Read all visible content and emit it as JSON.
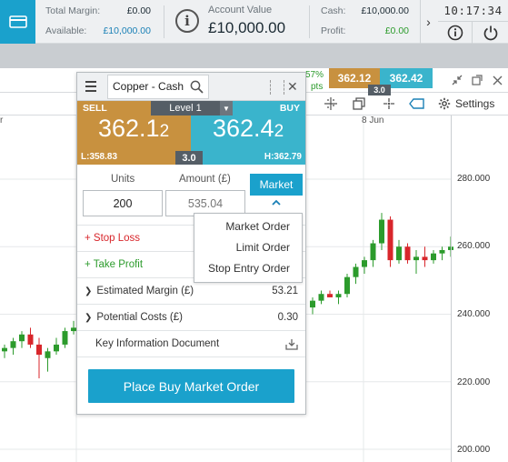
{
  "account_bar": {
    "total_margin_label": "Total Margin:",
    "total_margin_value": "£0.00",
    "available_label": "Available:",
    "available_value": "£10,000.00",
    "account_value_label": "Account Value",
    "account_value": "£10,000.00",
    "cash_label": "Cash:",
    "cash_value": "£10,000.00",
    "profit_label": "Profit:",
    "profit_value": "£0.00",
    "clock": "10:17:34",
    "icons": [
      "wallet-icon",
      "info-icon",
      "chevron-right-icon",
      "help-icon",
      "power-icon"
    ]
  },
  "chart_window": {
    "change_pct_partial": "57%",
    "change_pts_partial": "pts",
    "mini_sell_price": "362.12",
    "mini_buy_price": "362.42",
    "mini_spread": "3.0",
    "settings_label": "Settings",
    "date_labels": [
      "r",
      "8 Jun"
    ],
    "y_axis_labels": [
      "280.000",
      "260.000",
      "240.000",
      "220.000",
      "200.000"
    ],
    "icons": [
      "collapse-icon",
      "popout-icon",
      "close-icon",
      "crosshair-icon",
      "layers-icon",
      "cursor-icon",
      "tag-icon",
      "gear-icon"
    ]
  },
  "deal_ticket": {
    "market_name": "Copper - Cash",
    "sell_label": "SELL",
    "buy_label": "BUY",
    "level_label": "Level 1",
    "sell_price_main": "362.1",
    "sell_price_small": "2",
    "buy_price_main": "362.4",
    "buy_price_small": "2",
    "spread": "3.0",
    "low_label": "L:358.83",
    "high_label": "H:362.79",
    "units_label": "Units",
    "amount_label": "Amount (£)",
    "units_value": "200",
    "amount_placeholder": "535.04",
    "order_type_label": "Market",
    "stop_loss_label": "+ Stop Loss",
    "take_profit_label": "+ Take Profit",
    "estimated_margin_label": "Estimated Margin (£)",
    "estimated_margin_value": "53.21",
    "potential_costs_label": "Potential Costs (£)",
    "potential_costs_value": "0.30",
    "kid_label": "Key Information Document",
    "place_order_label": "Place Buy Market Order"
  },
  "order_type_menu": {
    "options": [
      "Market Order",
      "Limit Order",
      "Stop Entry Order"
    ]
  },
  "colors": {
    "accent": "#1aa1cc",
    "sell": "#c8913f",
    "buy": "#3ab4cc",
    "candle_up": "#2c9b2c",
    "candle_down": "#d8262b"
  },
  "chart_data": {
    "type": "candlestick",
    "x_labels": [
      "8 Jun"
    ],
    "y_ticks": [
      280,
      260,
      240,
      220,
      200
    ],
    "left_candles": [
      {
        "o": 229,
        "h": 231,
        "l": 227,
        "c": 230
      },
      {
        "o": 230,
        "h": 233,
        "l": 228,
        "c": 232
      },
      {
        "o": 232,
        "h": 235,
        "l": 230,
        "c": 234
      },
      {
        "o": 234,
        "h": 236,
        "l": 230,
        "c": 231
      },
      {
        "o": 231,
        "h": 233,
        "l": 221,
        "c": 228
      },
      {
        "o": 227,
        "h": 230,
        "l": 223,
        "c": 229
      },
      {
        "o": 229,
        "h": 233,
        "l": 228,
        "c": 231
      },
      {
        "o": 231,
        "h": 236,
        "l": 230,
        "c": 235
      },
      {
        "o": 235,
        "h": 238,
        "l": 234,
        "c": 236
      }
    ],
    "right_candles": [
      {
        "o": 242,
        "h": 245,
        "l": 240,
        "c": 244
      },
      {
        "o": 244,
        "h": 247,
        "l": 243,
        "c": 246
      },
      {
        "o": 246,
        "h": 247,
        "l": 245,
        "c": 245
      },
      {
        "o": 245,
        "h": 247,
        "l": 243,
        "c": 246
      },
      {
        "o": 246,
        "h": 252,
        "l": 245,
        "c": 251
      },
      {
        "o": 251,
        "h": 255,
        "l": 249,
        "c": 254
      },
      {
        "o": 254,
        "h": 257,
        "l": 252,
        "c": 256
      },
      {
        "o": 256,
        "h": 262,
        "l": 254,
        "c": 261
      },
      {
        "o": 261,
        "h": 270,
        "l": 259,
        "c": 268
      },
      {
        "o": 268,
        "h": 269,
        "l": 254,
        "c": 256
      },
      {
        "o": 256,
        "h": 262,
        "l": 255,
        "c": 260
      },
      {
        "o": 260,
        "h": 261,
        "l": 255,
        "c": 256
      },
      {
        "o": 256,
        "h": 259,
        "l": 252,
        "c": 257
      },
      {
        "o": 257,
        "h": 260,
        "l": 254,
        "c": 256
      },
      {
        "o": 256,
        "h": 259,
        "l": 255,
        "c": 258
      },
      {
        "o": 258,
        "h": 260,
        "l": 256,
        "c": 259
      },
      {
        "o": 259,
        "h": 263,
        "l": 257,
        "c": 260
      }
    ]
  }
}
